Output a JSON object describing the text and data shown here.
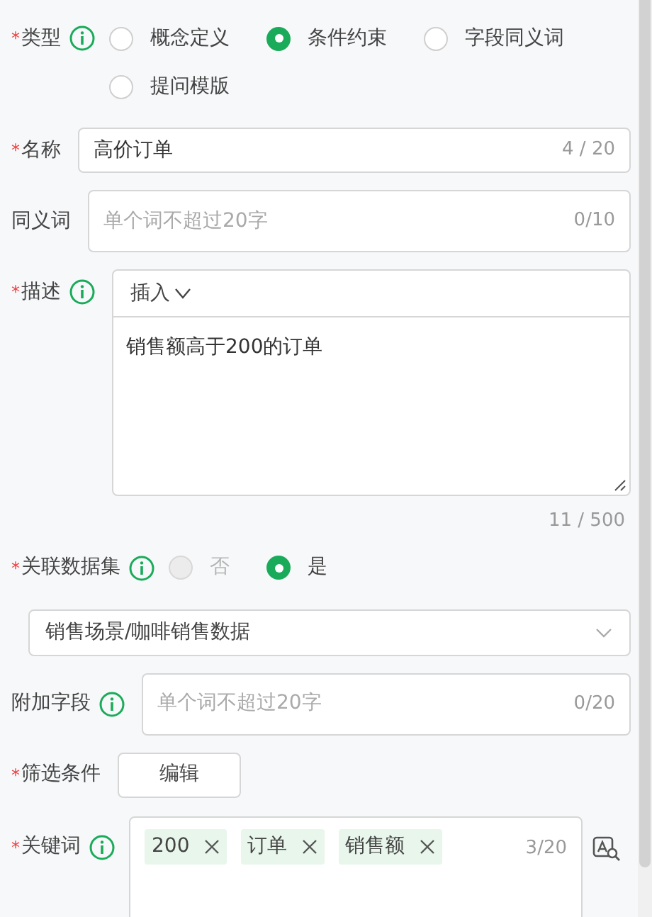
{
  "fields": [
    {
      "kind": "radio",
      "label": "类型",
      "required_mark": "*",
      "info": true,
      "options": [
        {
          "label": "概念定义",
          "selected": false,
          "disabled": false
        },
        {
          "label": "条件约束",
          "selected": true,
          "disabled": false
        },
        {
          "label": "字段同义词",
          "selected": false,
          "disabled": false
        },
        {
          "label": "提问模版",
          "selected": false,
          "disabled": false
        }
      ]
    },
    {
      "kind": "input",
      "label": "名称",
      "required_mark": "*",
      "info": false,
      "value": "高价订单",
      "counter": "4 / 20"
    },
    {
      "kind": "input",
      "label": "同义词",
      "info": false,
      "placeholder": "单个词不超过20字",
      "counter": "0/10"
    },
    {
      "kind": "editor",
      "label": "描述",
      "required_mark": "*",
      "info": true,
      "toolbar": "插入",
      "value": "销售额高于200的订单",
      "counter": "11 / 500"
    },
    {
      "kind": "radio",
      "label": "关联数据集",
      "required_mark": "*",
      "info": true,
      "options": [
        {
          "label": "否",
          "selected": false,
          "disabled": true
        },
        {
          "label": "是",
          "selected": true,
          "disabled": false
        }
      ]
    },
    {
      "kind": "select",
      "value": "销售场景/咖啡销售数据"
    },
    {
      "kind": "input",
      "label": "附加字段",
      "info": true,
      "placeholder": "单个词不超过20字",
      "counter": "0/20"
    },
    {
      "kind": "button",
      "label": "筛选条件",
      "required_mark": "*",
      "info": false,
      "button": "编辑"
    },
    {
      "kind": "tags",
      "label": "关键词",
      "required_mark": "*",
      "info": true,
      "tags": [
        "200",
        "订单",
        "销售额"
      ],
      "counter": "3/20"
    }
  ]
}
